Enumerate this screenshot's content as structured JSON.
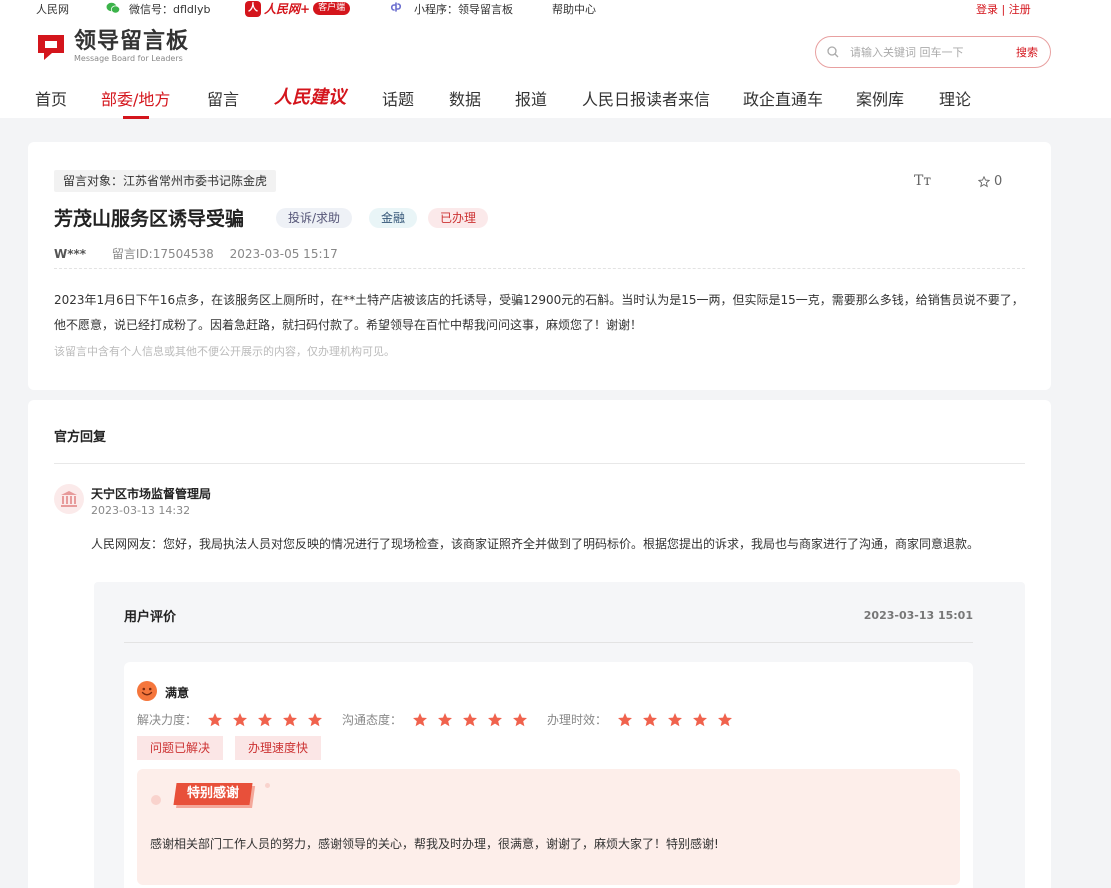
{
  "topbar": {
    "site": "人民网",
    "wechat": "微信号：dfldlyb",
    "app_brand": "人民网+",
    "app_badge": "客户端",
    "miniprogram": "小程序：领导留言板",
    "help": "帮助中心",
    "auth": "登录 | 注册"
  },
  "header": {
    "logo_title": "领导留言板",
    "logo_sub": "Message Board for Leaders",
    "search_placeholder": "请输入关键词 回车一下",
    "search_button": "搜索",
    "nav": [
      "首页",
      "部委/地方",
      "留言",
      "人民建议",
      "话题",
      "数据",
      "报道",
      "人民日报读者来信",
      "政企直通车",
      "案例库",
      "理论"
    ]
  },
  "message": {
    "target": "留言对象：江苏省常州市委书记陈金虎",
    "font_icon_text": "Tт",
    "favorites": "0",
    "title": "芳茂山服务区诱导受骗",
    "type_tag": "投诉/求助",
    "domain_tag": "金融",
    "status_tag": "已办理",
    "user": "W***",
    "message_id": "留言ID:17504538",
    "time": "2023-03-05 15:17",
    "body": "2023年1月6日下午16点多，在该服务区上厕所时，在**土特产店被该店的托诱导，受骗12900元的石斛。当时认为是15一两，但实际是15一克，需要那么多钱，给销售员说不要了，他不愿意，说已经打成粉了。因着急赶路，就扫码付款了。希望领导在百忙中帮我问问这事，麻烦您了！谢谢！",
    "note": "该留言中含有个人信息或其他不便公开展示的内容，仅办理机构可见。"
  },
  "reply": {
    "heading": "官方回复",
    "department": "天宁区市场监督管理局",
    "time": "2023-03-13 14:32",
    "body": "人民网网友：您好，我局执法人员对您反映的情况进行了现场检查，该商家证照齐全并做到了明码标价。根据您提出的诉求，我局也与商家进行了沟通，商家同意退款。"
  },
  "evaluation": {
    "heading": "用户评价",
    "time": "2023-03-13 15:01",
    "satisfaction": "满意",
    "ratings": [
      {
        "label": "解决力度：",
        "stars": 5
      },
      {
        "label": "沟通态度：",
        "stars": 5
      },
      {
        "label": "办理时效：",
        "stars": 5
      }
    ],
    "chips": [
      "问题已解决",
      "办理速度快"
    ],
    "thanks_title": "特别感谢",
    "thanks_text": "感谢相关部门工作人员的努力，感谢领导的关心，帮我及时办理，很满意，谢谢了，麻烦大家了！特别感谢!"
  },
  "colors": {
    "brand_red": "#d4151c",
    "star": "#f0624d",
    "ribbon": "#e8503a"
  }
}
